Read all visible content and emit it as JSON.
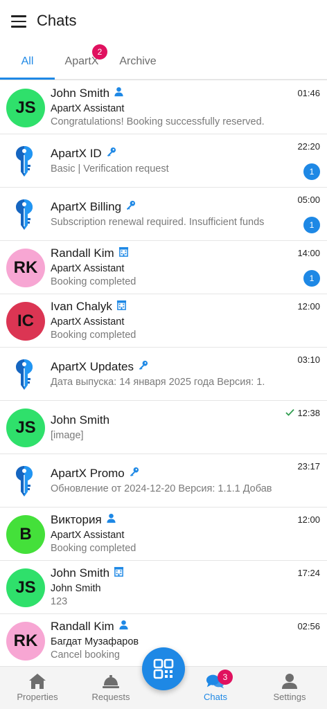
{
  "app": {
    "title": "Chats",
    "menu_icon": "hamburger-menu-icon"
  },
  "tabs": [
    {
      "label": "All",
      "active": true
    },
    {
      "label": "ApartX",
      "badge": "2"
    },
    {
      "label": "Archive"
    }
  ],
  "colors": {
    "accent": "#1e88e5",
    "badge": "#e0115f",
    "unread": "#1e88e5"
  },
  "chats": [
    {
      "avatar_text": "JS",
      "avatar_color": "#2fe06b",
      "name": "John Smith",
      "name_icon": "person-icon",
      "line1": "ApartX Assistant",
      "line2": "Congratulations! Booking successfully reserved.",
      "time": "01:46"
    },
    {
      "avatar_icon": "key-icon",
      "name": "ApartX ID",
      "name_icon": "key-icon",
      "line2": "Basic | Verification request",
      "time": "22:20",
      "unread": "1"
    },
    {
      "avatar_icon": "key-icon",
      "name": "ApartX Billing",
      "name_icon": "key-icon",
      "line2": "Subscription renewal required. Insufficient funds",
      "time": "05:00",
      "unread": "1"
    },
    {
      "avatar_text": "RK",
      "avatar_color": "#f7a6d3",
      "name": "Randall Kim",
      "name_icon": "building-icon",
      "line1": "ApartX Assistant",
      "line2": "Booking completed",
      "time": "14:00",
      "unread": "1"
    },
    {
      "avatar_text": "IC",
      "avatar_color": "#db3553",
      "name": "Ivan Chalyk",
      "name_icon": "building-icon",
      "line1": "ApartX Assistant",
      "line2": "Booking completed",
      "time": "12:00"
    },
    {
      "avatar_icon": "key-icon",
      "name": "ApartX Updates",
      "name_icon": "key-icon",
      "line2": "Дата выпуска: 14 января 2025 года Версия: 1.",
      "time": "03:10"
    },
    {
      "avatar_text": "JS",
      "avatar_color": "#2fe06b",
      "name": "John Smith",
      "line2": "[image]",
      "time": "12:38",
      "status_icon": "checkmark-icon"
    },
    {
      "avatar_icon": "key-icon",
      "name": "ApartX Promo",
      "name_icon": "key-icon",
      "line2": "Обновление от 2024-12-20 Версия: 1.1.1 Добав",
      "time": "23:17"
    },
    {
      "avatar_text": "B",
      "avatar_color": "#44e03a",
      "name": "Виктория",
      "name_icon": "person-icon",
      "line1": "ApartX Assistant",
      "line2": "Booking completed",
      "time": "12:00"
    },
    {
      "avatar_text": "JS",
      "avatar_color": "#2fe06b",
      "name": "John Smith",
      "name_icon": "building-icon",
      "line1": "John Smith",
      "line2": "123",
      "time": "17:24"
    },
    {
      "avatar_text": "RK",
      "avatar_color": "#f7a6d3",
      "name": "Randall Kim",
      "name_icon": "person-icon",
      "line1": "Багдат Музафаров",
      "line2": "Cancel booking",
      "time": "02:56"
    }
  ],
  "bottom_nav": [
    {
      "label": "Properties",
      "icon": "home-icon"
    },
    {
      "label": "Requests",
      "icon": "service-bell-icon"
    },
    {
      "label": "Chats",
      "icon": "chat-bubbles-icon",
      "active": true,
      "badge": "3"
    },
    {
      "label": "Settings",
      "icon": "person-icon"
    }
  ],
  "fab": {
    "icon": "qr-code-icon"
  }
}
